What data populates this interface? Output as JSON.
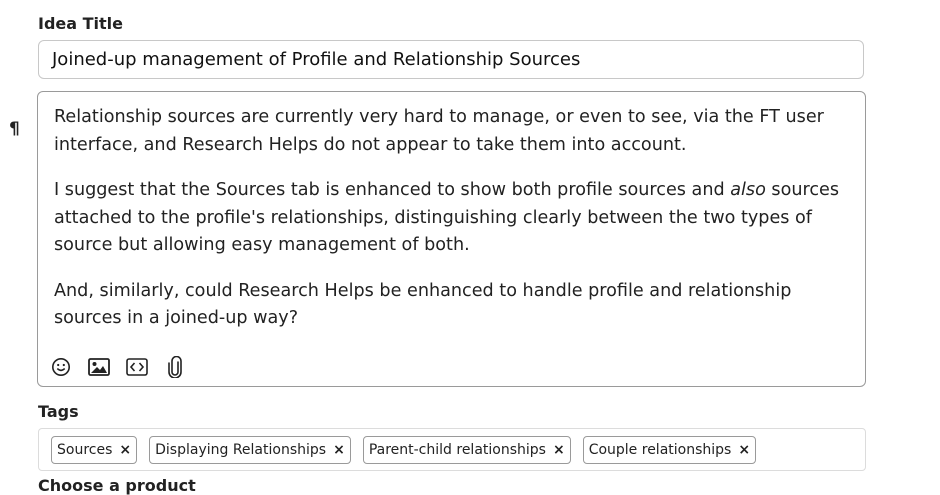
{
  "idea_title": {
    "label": "Idea Title",
    "value": "Joined-up management of Profile and Relationship Sources"
  },
  "editor": {
    "paragraph_mark": "¶",
    "paragraphs": [
      {
        "text": "Relationship sources are currently very hard to manage, or even to see, via the FT user interface, and Research Helps do not appear to take them into account."
      },
      {
        "before": "I suggest that the Sources tab is enhanced to show both profile sources and ",
        "em": "also",
        "after": " sources attached to the profile's relationships, distinguishing clearly between the two types of source but allowing easy management of both."
      },
      {
        "text": "And, similarly, could Research Helps be enhanced to handle profile and relationship sources in a joined-up way?"
      }
    ],
    "toolbar": [
      "emoji-icon",
      "image-icon",
      "code-icon",
      "attachment-icon"
    ]
  },
  "tags": {
    "label": "Tags",
    "items": [
      "Sources",
      "Displaying Relationships",
      "Parent-child relationships",
      "Couple relationships"
    ],
    "remove_glyph": "×"
  },
  "next_section_label": "Choose a product"
}
